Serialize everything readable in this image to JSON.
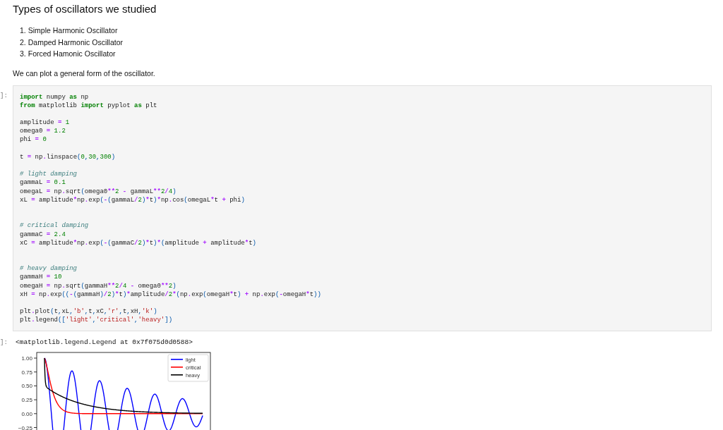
{
  "heading": "Types of oscillators we studied",
  "list": [
    {
      "number": "1.",
      "text": "Simple Harmonic Oscillator"
    },
    {
      "number": "2.",
      "text": "Damped Harmonic Oscillator"
    },
    {
      "number": "3.",
      "text": "Forced Hamonic Oscillator"
    }
  ],
  "paragraph": "We can plot a general form of the oscillator.",
  "code_cell": {
    "prompt": "]:",
    "lines": [
      {
        "kind": "code",
        "seg": [
          {
            "kind": "keyword",
            "text": "import"
          },
          {
            "kind": "plain",
            "text": " numpy "
          },
          {
            "kind": "keyword",
            "text": "as"
          },
          {
            "kind": "plain",
            "text": " np"
          }
        ]
      },
      {
        "kind": "code",
        "seg": [
          {
            "kind": "keyword",
            "text": "from"
          },
          {
            "kind": "plain",
            "text": " matplotlib "
          },
          {
            "kind": "keyword",
            "text": "import"
          },
          {
            "kind": "plain",
            "text": " pyplot "
          },
          {
            "kind": "keyword",
            "text": "as"
          },
          {
            "kind": "plain",
            "text": " plt"
          }
        ]
      },
      {
        "kind": "blank"
      },
      {
        "kind": "code",
        "seg": [
          {
            "kind": "plain",
            "text": "amplitude "
          },
          {
            "kind": "operator",
            "text": "="
          },
          {
            "kind": "number",
            "text": " 1"
          }
        ]
      },
      {
        "kind": "code",
        "seg": [
          {
            "kind": "plain",
            "text": "omega0 "
          },
          {
            "kind": "operator",
            "text": "="
          },
          {
            "kind": "number",
            "text": " 1.2"
          }
        ]
      },
      {
        "kind": "code",
        "seg": [
          {
            "kind": "plain",
            "text": "phi "
          },
          {
            "kind": "operator",
            "text": "="
          },
          {
            "kind": "number",
            "text": " 0"
          }
        ]
      },
      {
        "kind": "blank"
      },
      {
        "kind": "code",
        "seg": [
          {
            "kind": "plain",
            "text": "t "
          },
          {
            "kind": "operator",
            "text": "="
          },
          {
            "kind": "plain",
            "text": " np"
          },
          {
            "kind": "operator",
            "text": "."
          },
          {
            "kind": "plain",
            "text": "linspace"
          },
          {
            "kind": "bracket",
            "text": "("
          },
          {
            "kind": "number",
            "text": "0"
          },
          {
            "kind": "bracket",
            "text": ","
          },
          {
            "kind": "number",
            "text": "30"
          },
          {
            "kind": "bracket",
            "text": ","
          },
          {
            "kind": "number",
            "text": "300"
          },
          {
            "kind": "bracket",
            "text": ")"
          }
        ]
      },
      {
        "kind": "blank"
      },
      {
        "kind": "code",
        "seg": [
          {
            "kind": "comment",
            "text": "# light damping"
          }
        ]
      },
      {
        "kind": "code",
        "seg": [
          {
            "kind": "plain",
            "text": "gammaL "
          },
          {
            "kind": "operator",
            "text": "="
          },
          {
            "kind": "number",
            "text": " 0.1"
          }
        ]
      },
      {
        "kind": "code",
        "seg": [
          {
            "kind": "plain",
            "text": "omegaL "
          },
          {
            "kind": "operator",
            "text": "="
          },
          {
            "kind": "plain",
            "text": " np"
          },
          {
            "kind": "operator",
            "text": "."
          },
          {
            "kind": "plain",
            "text": "sqrt"
          },
          {
            "kind": "bracket",
            "text": "("
          },
          {
            "kind": "plain",
            "text": "omega0"
          },
          {
            "kind": "operator",
            "text": "**"
          },
          {
            "kind": "number",
            "text": "2"
          },
          {
            "kind": "operator",
            "text": " -"
          },
          {
            "kind": "plain",
            "text": " gammaL"
          },
          {
            "kind": "operator",
            "text": "**"
          },
          {
            "kind": "number",
            "text": "2"
          },
          {
            "kind": "operator",
            "text": "/"
          },
          {
            "kind": "number",
            "text": "4"
          },
          {
            "kind": "bracket",
            "text": ")"
          }
        ]
      },
      {
        "kind": "code",
        "seg": [
          {
            "kind": "plain",
            "text": "xL "
          },
          {
            "kind": "operator",
            "text": "="
          },
          {
            "kind": "plain",
            "text": " amplitude"
          },
          {
            "kind": "operator",
            "text": "*"
          },
          {
            "kind": "plain",
            "text": "np"
          },
          {
            "kind": "operator",
            "text": "."
          },
          {
            "kind": "plain",
            "text": "exp"
          },
          {
            "kind": "bracket",
            "text": "("
          },
          {
            "kind": "operator",
            "text": "-"
          },
          {
            "kind": "bracket",
            "text": "("
          },
          {
            "kind": "plain",
            "text": "gammaL"
          },
          {
            "kind": "operator",
            "text": "/"
          },
          {
            "kind": "number",
            "text": "2"
          },
          {
            "kind": "bracket",
            "text": ")"
          },
          {
            "kind": "operator",
            "text": "*"
          },
          {
            "kind": "plain",
            "text": "t"
          },
          {
            "kind": "bracket",
            "text": ")"
          },
          {
            "kind": "operator",
            "text": "*"
          },
          {
            "kind": "plain",
            "text": "np"
          },
          {
            "kind": "operator",
            "text": "."
          },
          {
            "kind": "plain",
            "text": "cos"
          },
          {
            "kind": "bracket",
            "text": "("
          },
          {
            "kind": "plain",
            "text": "omegaL"
          },
          {
            "kind": "operator",
            "text": "*"
          },
          {
            "kind": "plain",
            "text": "t "
          },
          {
            "kind": "operator",
            "text": "+"
          },
          {
            "kind": "plain",
            "text": " phi"
          },
          {
            "kind": "bracket",
            "text": ")"
          }
        ]
      },
      {
        "kind": "blank"
      },
      {
        "kind": "blank"
      },
      {
        "kind": "code",
        "seg": [
          {
            "kind": "comment",
            "text": "# critical damping"
          }
        ]
      },
      {
        "kind": "code",
        "seg": [
          {
            "kind": "plain",
            "text": "gammaC "
          },
          {
            "kind": "operator",
            "text": "="
          },
          {
            "kind": "number",
            "text": " 2.4"
          }
        ]
      },
      {
        "kind": "code",
        "seg": [
          {
            "kind": "plain",
            "text": "xC "
          },
          {
            "kind": "operator",
            "text": "="
          },
          {
            "kind": "plain",
            "text": " amplitude"
          },
          {
            "kind": "operator",
            "text": "*"
          },
          {
            "kind": "plain",
            "text": "np"
          },
          {
            "kind": "operator",
            "text": "."
          },
          {
            "kind": "plain",
            "text": "exp"
          },
          {
            "kind": "bracket",
            "text": "("
          },
          {
            "kind": "operator",
            "text": "-"
          },
          {
            "kind": "bracket",
            "text": "("
          },
          {
            "kind": "plain",
            "text": "gammaC"
          },
          {
            "kind": "operator",
            "text": "/"
          },
          {
            "kind": "number",
            "text": "2"
          },
          {
            "kind": "bracket",
            "text": ")"
          },
          {
            "kind": "operator",
            "text": "*"
          },
          {
            "kind": "plain",
            "text": "t"
          },
          {
            "kind": "bracket",
            "text": ")"
          },
          {
            "kind": "operator",
            "text": "*"
          },
          {
            "kind": "bracket",
            "text": "("
          },
          {
            "kind": "plain",
            "text": "amplitude "
          },
          {
            "kind": "operator",
            "text": "+"
          },
          {
            "kind": "plain",
            "text": " amplitude"
          },
          {
            "kind": "operator",
            "text": "*"
          },
          {
            "kind": "plain",
            "text": "t"
          },
          {
            "kind": "bracket",
            "text": ")"
          }
        ]
      },
      {
        "kind": "blank"
      },
      {
        "kind": "blank"
      },
      {
        "kind": "code",
        "seg": [
          {
            "kind": "comment",
            "text": "# heavy damping"
          }
        ]
      },
      {
        "kind": "code",
        "seg": [
          {
            "kind": "plain",
            "text": "gammaH "
          },
          {
            "kind": "operator",
            "text": "="
          },
          {
            "kind": "number",
            "text": " 10"
          }
        ]
      },
      {
        "kind": "code",
        "seg": [
          {
            "kind": "plain",
            "text": "omegaH "
          },
          {
            "kind": "operator",
            "text": "="
          },
          {
            "kind": "plain",
            "text": " np"
          },
          {
            "kind": "operator",
            "text": "."
          },
          {
            "kind": "plain",
            "text": "sqrt"
          },
          {
            "kind": "bracket",
            "text": "("
          },
          {
            "kind": "plain",
            "text": "gammaH"
          },
          {
            "kind": "operator",
            "text": "**"
          },
          {
            "kind": "number",
            "text": "2"
          },
          {
            "kind": "operator",
            "text": "/"
          },
          {
            "kind": "number",
            "text": "4"
          },
          {
            "kind": "operator",
            "text": " -"
          },
          {
            "kind": "plain",
            "text": " omega0"
          },
          {
            "kind": "operator",
            "text": "**"
          },
          {
            "kind": "number",
            "text": "2"
          },
          {
            "kind": "bracket",
            "text": ")"
          }
        ]
      },
      {
        "kind": "code",
        "seg": [
          {
            "kind": "plain",
            "text": "xH "
          },
          {
            "kind": "operator",
            "text": "="
          },
          {
            "kind": "plain",
            "text": " np"
          },
          {
            "kind": "operator",
            "text": "."
          },
          {
            "kind": "plain",
            "text": "exp"
          },
          {
            "kind": "bracket",
            "text": "(("
          },
          {
            "kind": "operator",
            "text": "-"
          },
          {
            "kind": "bracket",
            "text": "("
          },
          {
            "kind": "plain",
            "text": "gammaH"
          },
          {
            "kind": "bracket",
            "text": ")"
          },
          {
            "kind": "operator",
            "text": "/"
          },
          {
            "kind": "number",
            "text": "2"
          },
          {
            "kind": "bracket",
            "text": ")"
          },
          {
            "kind": "operator",
            "text": "*"
          },
          {
            "kind": "plain",
            "text": "t"
          },
          {
            "kind": "bracket",
            "text": ")"
          },
          {
            "kind": "operator",
            "text": "*"
          },
          {
            "kind": "plain",
            "text": "amplitude"
          },
          {
            "kind": "operator",
            "text": "/"
          },
          {
            "kind": "number",
            "text": "2"
          },
          {
            "kind": "operator",
            "text": "*"
          },
          {
            "kind": "bracket",
            "text": "("
          },
          {
            "kind": "plain",
            "text": "np"
          },
          {
            "kind": "operator",
            "text": "."
          },
          {
            "kind": "plain",
            "text": "exp"
          },
          {
            "kind": "bracket",
            "text": "("
          },
          {
            "kind": "plain",
            "text": "omegaH"
          },
          {
            "kind": "operator",
            "text": "*"
          },
          {
            "kind": "plain",
            "text": "t"
          },
          {
            "kind": "bracket",
            "text": ")"
          },
          {
            "kind": "operator",
            "text": " +"
          },
          {
            "kind": "plain",
            "text": " np"
          },
          {
            "kind": "operator",
            "text": "."
          },
          {
            "kind": "plain",
            "text": "exp"
          },
          {
            "kind": "bracket",
            "text": "("
          },
          {
            "kind": "operator",
            "text": "-"
          },
          {
            "kind": "plain",
            "text": "omegaH"
          },
          {
            "kind": "operator",
            "text": "*"
          },
          {
            "kind": "plain",
            "text": "t"
          },
          {
            "kind": "bracket",
            "text": "))"
          }
        ]
      },
      {
        "kind": "blank"
      },
      {
        "kind": "code",
        "seg": [
          {
            "kind": "plain",
            "text": "plt"
          },
          {
            "kind": "operator",
            "text": "."
          },
          {
            "kind": "plain",
            "text": "plot"
          },
          {
            "kind": "bracket",
            "text": "("
          },
          {
            "kind": "plain",
            "text": "t"
          },
          {
            "kind": "bracket",
            "text": ","
          },
          {
            "kind": "plain",
            "text": "xL"
          },
          {
            "kind": "bracket",
            "text": ","
          },
          {
            "kind": "string",
            "text": "'b'"
          },
          {
            "kind": "bracket",
            "text": ","
          },
          {
            "kind": "plain",
            "text": "t"
          },
          {
            "kind": "bracket",
            "text": ","
          },
          {
            "kind": "plain",
            "text": "xC"
          },
          {
            "kind": "bracket",
            "text": ","
          },
          {
            "kind": "string",
            "text": "'r'"
          },
          {
            "kind": "bracket",
            "text": ","
          },
          {
            "kind": "plain",
            "text": "t"
          },
          {
            "kind": "bracket",
            "text": ","
          },
          {
            "kind": "plain",
            "text": "xH"
          },
          {
            "kind": "bracket",
            "text": ","
          },
          {
            "kind": "string",
            "text": "'k'"
          },
          {
            "kind": "bracket",
            "text": ")"
          }
        ]
      },
      {
        "kind": "code",
        "seg": [
          {
            "kind": "plain",
            "text": "plt"
          },
          {
            "kind": "operator",
            "text": "."
          },
          {
            "kind": "plain",
            "text": "legend"
          },
          {
            "kind": "bracket",
            "text": "(["
          },
          {
            "kind": "string",
            "text": "'light'"
          },
          {
            "kind": "bracket",
            "text": ","
          },
          {
            "kind": "string",
            "text": "'critical'"
          },
          {
            "kind": "bracket",
            "text": ","
          },
          {
            "kind": "string",
            "text": "'heavy'"
          },
          {
            "kind": "bracket",
            "text": "])"
          }
        ]
      }
    ]
  },
  "output": {
    "prompt": "]:",
    "text": "<matplotlib.legend.Legend at 0x7f075d0d0588>"
  },
  "plot": {
    "y_ticks": [
      "1.00",
      "0.75",
      "0.50",
      "0.25",
      "0.00",
      "−0.25"
    ],
    "legend": [
      {
        "label": "light",
        "color": "#0000ff",
        "kind": "underdamped"
      },
      {
        "label": "critical",
        "color": "#ff0000",
        "kind": "critical"
      },
      {
        "label": "heavy",
        "color": "#000000",
        "kind": "overdamped"
      }
    ]
  }
}
